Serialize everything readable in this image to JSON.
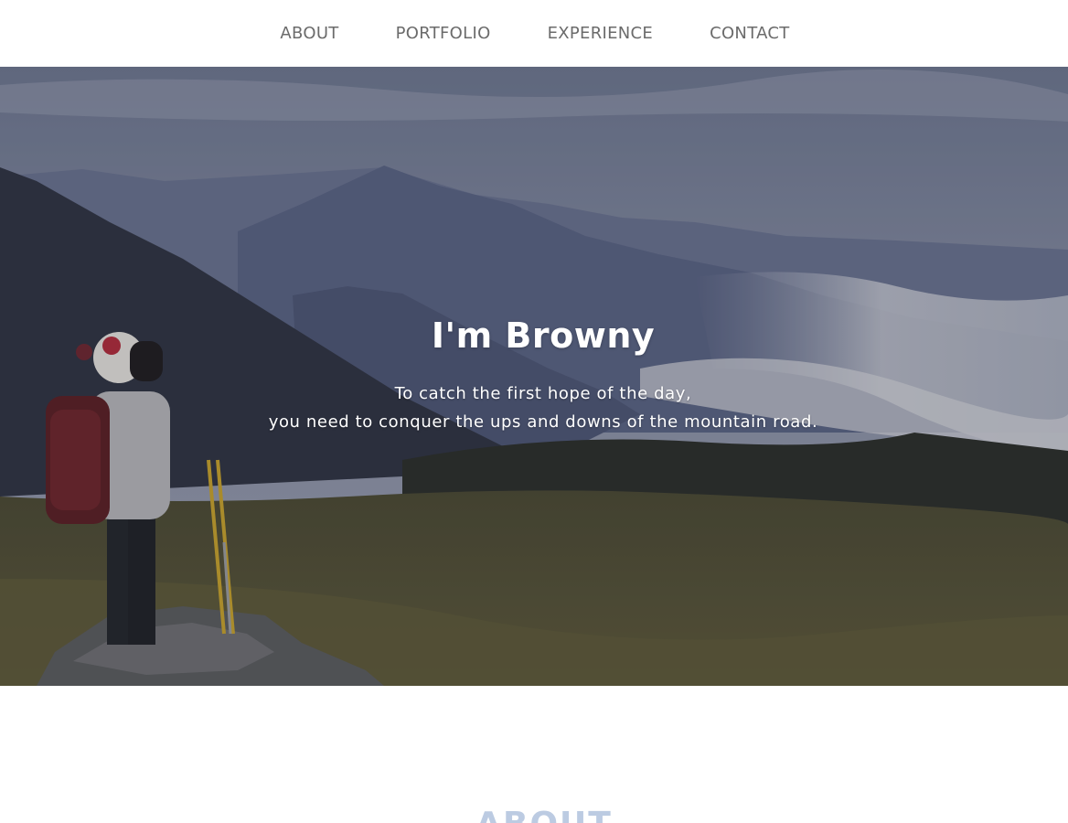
{
  "nav": {
    "items": [
      {
        "label": "ABOUT"
      },
      {
        "label": "PORTFOLIO"
      },
      {
        "label": "EXPERIENCE"
      },
      {
        "label": "CONTACT"
      }
    ]
  },
  "hero": {
    "title": "I'm Browny",
    "subtitle_line1": "To catch the first hope of the day,",
    "subtitle_line2": "you need to conquer the ups and downs of the mountain road."
  },
  "about": {
    "heading": "ABOUT"
  },
  "colors": {
    "nav_text": "#6b6b6b",
    "hero_text": "#ffffff",
    "section_heading": "#bccbe2"
  }
}
